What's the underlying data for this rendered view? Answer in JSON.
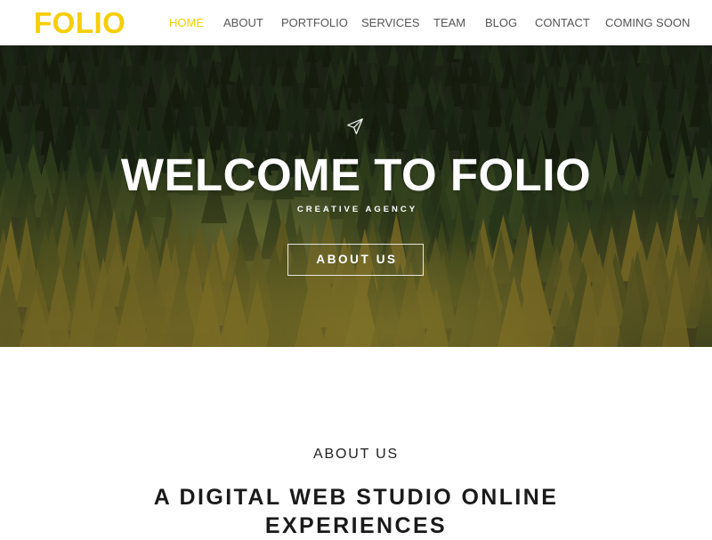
{
  "brand": {
    "logo": "FOLIO",
    "accent": "#f6ce05"
  },
  "nav": {
    "items": [
      {
        "label": "HOME",
        "active": true
      },
      {
        "label": "ABOUT"
      },
      {
        "label": "PORTFOLIO"
      },
      {
        "label": "SERVICES"
      },
      {
        "label": "TEAM"
      },
      {
        "label": "BLOG"
      },
      {
        "label": "CONTACT"
      },
      {
        "label": "COMING SOON"
      }
    ]
  },
  "hero": {
    "icon": "paper-plane-icon",
    "title": "WELCOME TO FOLIO",
    "subtitle": "CREATIVE AGENCY",
    "button_label": "ABOUT US"
  },
  "about": {
    "eyebrow": "ABOUT US",
    "heading": "A DIGITAL WEB STUDIO ONLINE EXPERIENCES"
  }
}
